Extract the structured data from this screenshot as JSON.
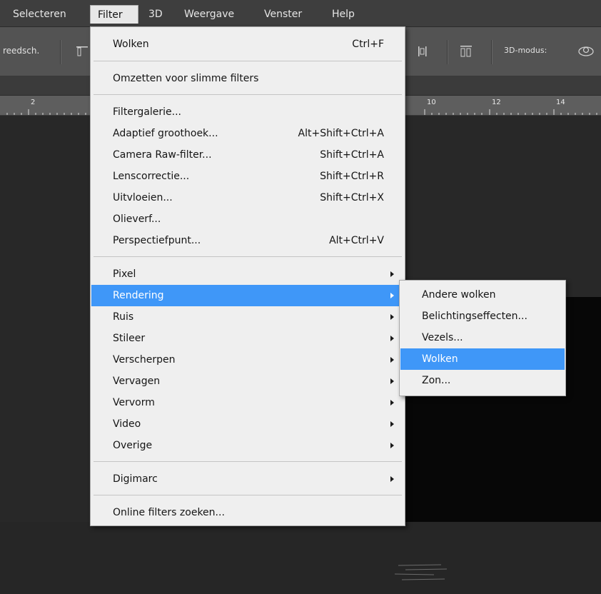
{
  "menubar": {
    "items": [
      {
        "label": "Selecteren"
      },
      {
        "label": "Filter"
      },
      {
        "label": "3D"
      },
      {
        "label": "Weergave"
      },
      {
        "label": "Venster"
      },
      {
        "label": "Help"
      }
    ]
  },
  "optionsbar": {
    "tool_label": "reedsch.",
    "mode_label": "3D-modus:"
  },
  "ruler": {
    "numbers": [
      "2",
      "10",
      "12",
      "14"
    ]
  },
  "filter_menu": {
    "last_filter": {
      "label": "Wolken",
      "shortcut": "Ctrl+F"
    },
    "smart": {
      "label": "Omzetten voor slimme filters"
    },
    "gallery": {
      "label": "Filtergalerie..."
    },
    "adaptive": {
      "label": "Adaptief groothoek...",
      "shortcut": "Alt+Shift+Ctrl+A"
    },
    "camera_raw": {
      "label": "Camera Raw-filter...",
      "shortcut": "Shift+Ctrl+A"
    },
    "lens": {
      "label": "Lenscorrectie...",
      "shortcut": "Shift+Ctrl+R"
    },
    "liquify": {
      "label": "Uitvloeien...",
      "shortcut": "Shift+Ctrl+X"
    },
    "oil": {
      "label": "Olieverf..."
    },
    "vanishing": {
      "label": "Perspectiefpunt...",
      "shortcut": "Alt+Ctrl+V"
    },
    "pixel": {
      "label": "Pixel"
    },
    "rendering": {
      "label": "Rendering"
    },
    "noise": {
      "label": "Ruis"
    },
    "stylize": {
      "label": "Stileer"
    },
    "sharpen": {
      "label": "Verscherpen"
    },
    "blur": {
      "label": "Vervagen"
    },
    "distort": {
      "label": "Vervorm"
    },
    "video": {
      "label": "Video"
    },
    "other": {
      "label": "Overige"
    },
    "digimarc": {
      "label": "Digimarc"
    },
    "browse": {
      "label": "Online filters zoeken..."
    }
  },
  "submenu": {
    "difference_clouds": {
      "label": "Andere wolken"
    },
    "lighting": {
      "label": "Belichtingseffecten..."
    },
    "fibers": {
      "label": "Vezels..."
    },
    "clouds": {
      "label": "Wolken"
    },
    "flare": {
      "label": "Zon..."
    }
  },
  "colors": {
    "highlight": "#3f97f8",
    "menu_bg": "#efefef",
    "menubar_bg": "#3e3e3e",
    "options_bg": "#535353"
  }
}
